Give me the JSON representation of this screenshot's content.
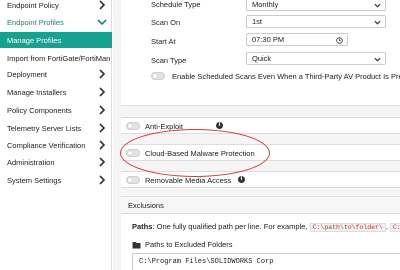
{
  "sidebar": {
    "items": [
      {
        "label": "Endpoint Policy"
      },
      {
        "label": "Endpoint Profiles"
      },
      {
        "label": "Deployment"
      },
      {
        "label": "Manage Installers"
      },
      {
        "label": "Policy Components"
      },
      {
        "label": "Telemetry Server Lists"
      },
      {
        "label": "Compliance Verification"
      },
      {
        "label": "Administration"
      },
      {
        "label": "System Settings"
      }
    ],
    "subitems": [
      {
        "label": "Manage Profiles"
      },
      {
        "label": "Import from FortiGate/FortiMan..."
      }
    ],
    "accent_color": "#15a38f"
  },
  "schedule": {
    "schedule_type_label": "Schedule Type",
    "schedule_type_value": "Monthly",
    "scan_on_label": "Scan On",
    "scan_on_value": "1st",
    "start_at_label": "Start At",
    "start_at_value": "07:30 PM",
    "scan_type_label": "Scan Type",
    "scan_type_value": "Quick",
    "third_party_label": "Enable Scheduled Scans Even When a Third-Party AV Product Is Present"
  },
  "features": {
    "anti_exploit_label": "Anti-Exploit",
    "cloud_malware_label": "Cloud-Based Malware Protection",
    "removable_media_label": "Removable Media Access"
  },
  "exclusions": {
    "header": "Exclusions",
    "paths_bold": "Paths",
    "paths_text": ": One fully qualified path per line. For example,",
    "example1": "C:\\path\\to\\folder\\",
    "example_sep": ",",
    "example2": "C:\\pa",
    "excluded_folders_label": "Paths to Excluded Folders",
    "excluded_folder_value": "C:\\Program Files\\SOLIDWORKS Corp"
  },
  "info_glyph": "i",
  "annotation_color": "#d23b3b"
}
